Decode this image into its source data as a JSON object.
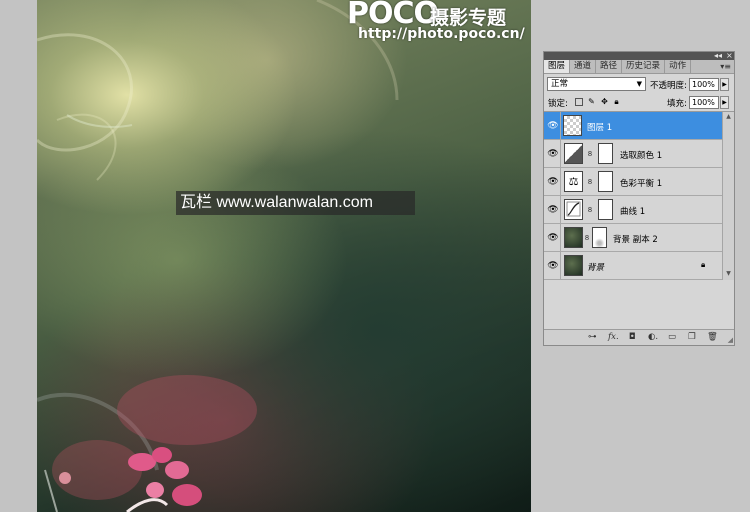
{
  "canvas": {
    "logo": {
      "brand": "POCO",
      "subtitle": "摄影专题",
      "url": "http://photo.poco.cn/"
    },
    "watermark": "瓦栏 www.walanwalan.com"
  },
  "layers_panel": {
    "tabs": [
      {
        "label": "图层",
        "active": true
      },
      {
        "label": "通道",
        "active": false
      },
      {
        "label": "路径",
        "active": false
      },
      {
        "label": "历史记录",
        "active": false
      },
      {
        "label": "动作",
        "active": false
      }
    ],
    "blend_mode": "正常",
    "opacity_label": "不透明度:",
    "opacity_value": "100%",
    "lock_label": "锁定:",
    "fill_label": "填充:",
    "fill_value": "100%",
    "layers": [
      {
        "name": "图层 1",
        "selected": true,
        "thumb": "transparent-layer-thumbnail",
        "has_mask": false,
        "locked": false
      },
      {
        "name": "选取颜色 1",
        "selected": false,
        "thumb": "selective-color-adjustment-icon",
        "has_mask": true,
        "locked": false
      },
      {
        "name": "色彩平衡 1",
        "selected": false,
        "thumb": "color-balance-adjustment-icon",
        "has_mask": true,
        "locked": false
      },
      {
        "name": "曲线 1",
        "selected": false,
        "thumb": "curves-adjustment-icon",
        "has_mask": true,
        "locked": false
      },
      {
        "name": "背景 副本 2",
        "selected": false,
        "thumb": "photo-thumbnail",
        "has_mask": true,
        "locked": false
      },
      {
        "name": "背景",
        "selected": false,
        "thumb": "photo-thumbnail",
        "has_mask": false,
        "locked": true
      }
    ],
    "colors": {
      "selection": "#3d8ee0",
      "panel_bg": "#d6d6d6",
      "workspace": "#c6c6c6"
    }
  }
}
